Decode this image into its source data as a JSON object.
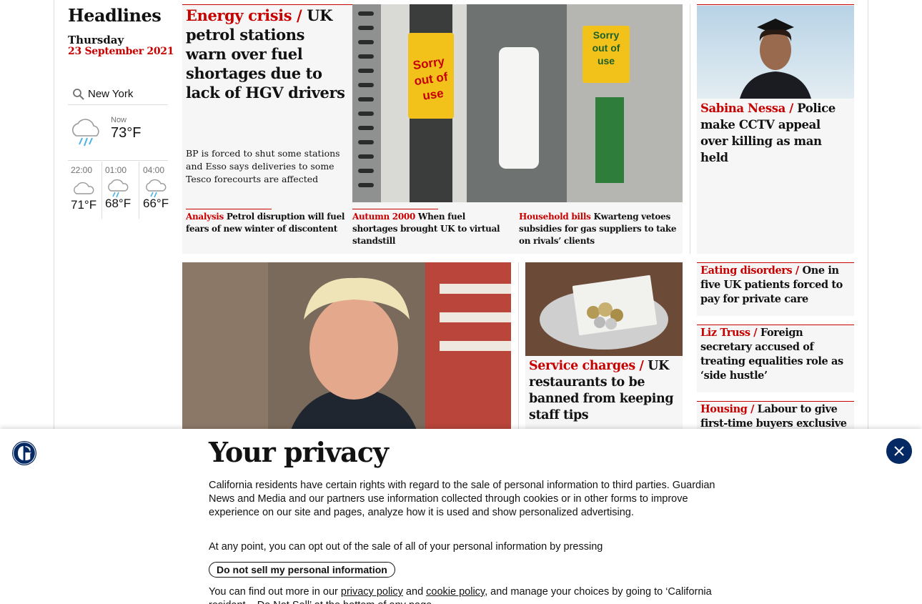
{
  "left": {
    "title": "Headlines",
    "day": "Thursday",
    "date": "23 September 2021"
  },
  "weather": {
    "location": "New York",
    "now_label": "Now",
    "now_temp": "73°F",
    "now_icon": "heavy-rain-icon",
    "forecast": [
      {
        "time": "22:00",
        "temp": "71°F",
        "icon": "cloud-icon"
      },
      {
        "time": "01:00",
        "temp": "68°F",
        "icon": "rain-icon"
      },
      {
        "time": "04:00",
        "temp": "66°F",
        "icon": "rain-icon"
      }
    ]
  },
  "main_story": {
    "kicker": "Energy crisis /",
    "headline": "UK petrol stations warn over fuel shortages due to lack of HGV drivers",
    "standfirst": "BP is forced to shut some stations and Esso says deliveries to some Tesco forecourts are affected",
    "image_signs": [
      "Sorry out of use",
      "Sorry out of use"
    ],
    "sublinks": [
      {
        "kicker": "Analysis",
        "text": "Petrol disruption will fuel fears of new winter of discontent"
      },
      {
        "kicker": "Autumn 2000",
        "text": "When fuel shortages brought UK to virtual standstill"
      },
      {
        "kicker": "Household bills",
        "text": "Kwarteng vetoes subsidies for gas suppliers to take on rivals’ clients"
      }
    ]
  },
  "right_top": {
    "kicker": "Sabina Nessa /",
    "headline": "Police make CCTV appeal over killing as man held"
  },
  "service": {
    "kicker": "Service charges /",
    "headline": "UK restaurants to be banned from keeping staff tips"
  },
  "right_list": [
    {
      "kicker": "Eating disorders /",
      "headline": "One in five UK patients forced to pay for private care"
    },
    {
      "kicker": "Liz Truss /",
      "headline": "Foreign secretary accused of treating equalities role as ‘side hustle’"
    },
    {
      "kicker": "Housing /",
      "headline": "Labour to give first-time buyers exclusive"
    }
  ],
  "privacy": {
    "title": "Your privacy",
    "para1": "California residents have certain rights with regard to the sale of personal information to third parties. Guardian News and Media and our partners use information collected through cookies or in other forms to improve experience on our site and pages, analyze how it is used and show personalized advertising.",
    "para2": "At any point, you can opt out of the sale of all of your personal information by pressing",
    "button": "Do not sell my personal information",
    "para3_a": "You can find out more in our ",
    "link1": "privacy policy",
    "para3_b": " and ",
    "link2": "cookie policy",
    "para3_c": ", and manage your choices by going to ‘California resident – Do Not Sell’ at the bottom of any page."
  },
  "colors": {
    "accent": "#c70000",
    "brand": "#052962",
    "card_bg": "#f6f6f6"
  }
}
